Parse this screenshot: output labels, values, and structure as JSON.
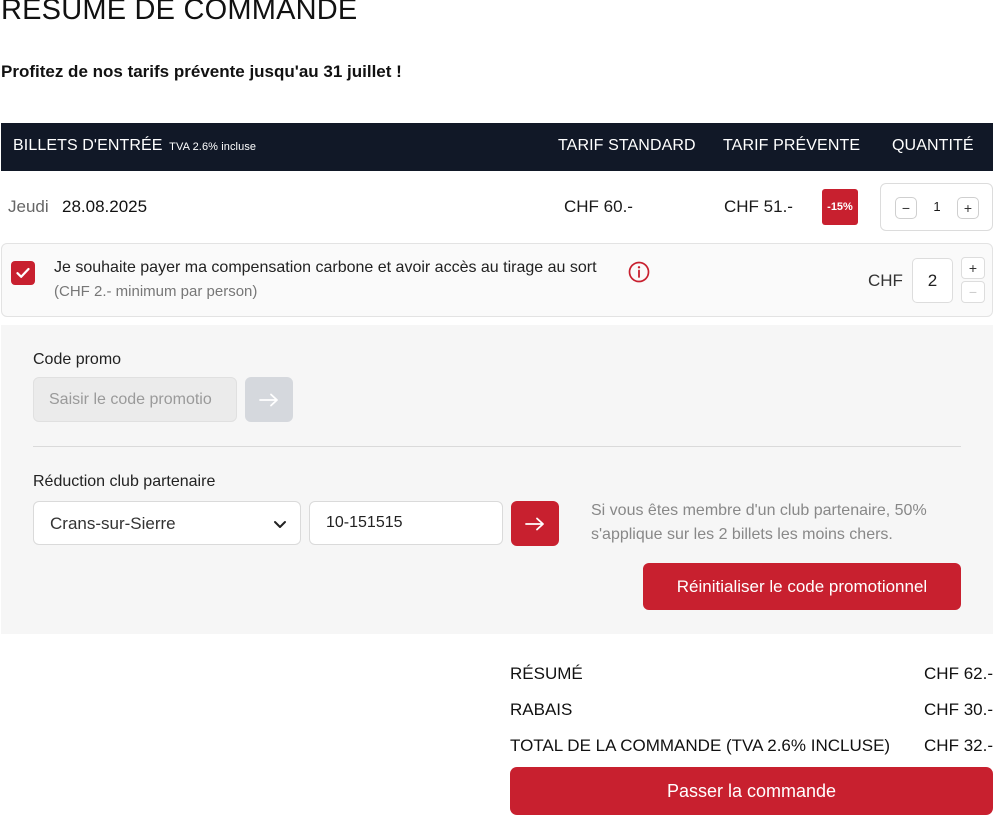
{
  "page_title": "RÉSUMÉ DE COMMANDE",
  "presale_notice": "Profitez de nos tarifs prévente jusqu'au 31 juillet !",
  "table": {
    "col_tickets": "BILLETS D'ENTRÉE",
    "col_tickets_tva": "TVA 2.6% incluse",
    "col_standard": "TARIF STANDARD",
    "col_presale": "TARIF PRÉVENTE",
    "col_quantity": "QUANTITÉ"
  },
  "ticket": {
    "day": "Jeudi",
    "date": "28.08.2025",
    "standard_price": "CHF 60.-",
    "presale_price": "CHF 51.-",
    "discount": "-15%",
    "quantity": "1",
    "minus": "−",
    "plus": "+"
  },
  "carbon": {
    "checked": true,
    "text": "Je souhaite payer ma compensation carbone et avoir accès au tirage au sort",
    "sub": "(CHF 2.- minimum par person)",
    "currency": "CHF",
    "amount": "2",
    "plus": "+",
    "minus": "−"
  },
  "promo": {
    "label": "Code promo",
    "placeholder": "Saisir le code promotio",
    "club_label": "Réduction club partenaire",
    "club_selected": "Crans-sur-Sierre",
    "club_code": "10-151515",
    "club_info": "Si vous êtes membre d'un club partenaire, 50% s'applique sur les 2 billets les moins chers.",
    "reset_label": "Réinitialiser le code promotionnel"
  },
  "summary": {
    "subtotal_label": "RÉSUMÉ",
    "subtotal": "CHF 62.-",
    "discount_label": "RABAIS",
    "discount": "CHF 30.-",
    "total_label": "TOTAL DE LA COMMANDE (TVA 2.6% INCLUSE)",
    "total": "CHF 32.-"
  },
  "order_button": "Passer la commande",
  "colors": {
    "accent": "#c8202f",
    "header_bg": "#111827",
    "panel_bg": "#f6f6f6"
  },
  "icons": {
    "check": "check-icon",
    "info": "info-circle-icon",
    "arrow": "arrow-right-icon",
    "chevron": "chevron-down-icon"
  }
}
